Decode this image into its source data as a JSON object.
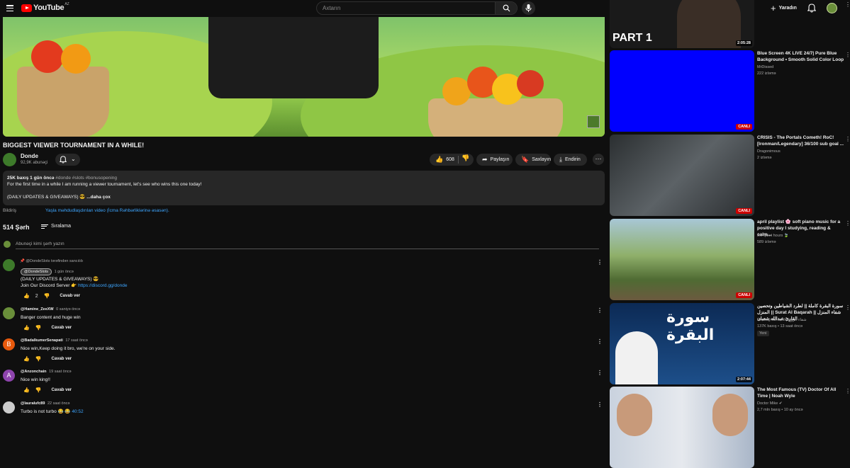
{
  "header": {
    "logo_text": "YouTube",
    "region": "AZ",
    "search_placeholder": "Axtarın",
    "create_label": "Yaradın"
  },
  "video": {
    "title": "BIGGEST VIEWER TOURNAMENT IN A WHILE!",
    "channel": "Donde",
    "subscribers": "92,9K abunəçi",
    "likes": "608",
    "share_label": "Paylaşın",
    "save_label": "Saxlayın",
    "download_label": "Endirin"
  },
  "description": {
    "meta": "25K baxış  1 gün öncə",
    "tags": "#donde #slots #bonusopening",
    "line1": "For the first time in a while I am running a viewer tournament, let's see who wins this one today!",
    "line2": "(DAILY UPDATES & GIVEAWAYS) 😎",
    "more": "...daha çox"
  },
  "notice": {
    "label": "Bildiriş",
    "link": "Yaşla məhdudlaşdırılan video (İcma Rəhbərliklərinə əsasən)."
  },
  "comments_section": {
    "count": "514 Şərh",
    "sort_label": "Sıralama",
    "add_placeholder": "Abunəçi kimi şərh yazın"
  },
  "comments": [
    {
      "pinned": "@DondeSlots tərəfindən sancılıb",
      "handle": "@DondeSlots",
      "time": "1 gün öncə",
      "text1": "(DAILY UPDATES & GIVEAWAYS) 😎",
      "text2": "Join Our Discord Server 👉 ",
      "link": "https://discord.gg/donde",
      "likes": "2",
      "reply": "Cavab ver",
      "avatar_letter": "",
      "avatar_color": "#3d7a2a"
    },
    {
      "handle": "@Hamine_ZeeXW",
      "time": "0 saniyə öncə",
      "text1": "Banger content and huge win",
      "reply": "Cavab ver",
      "avatar_letter": "",
      "avatar_color": "#6a8f3a"
    },
    {
      "handle": "@BadalkumerSenapati",
      "time": "17 saat öncə",
      "text1": "Nice win,Keep doing it bro, we're on your side.",
      "reply": "Cavab ver",
      "avatar_letter": "B",
      "avatar_color": "#e8590c"
    },
    {
      "handle": "@Anzonchain",
      "time": "19 saat öncə",
      "text1": "Nice win king!!",
      "reply": "Cavab ver",
      "avatar_letter": "A",
      "avatar_color": "#8e44ad"
    },
    {
      "handle": "@lauralufc89",
      "time": "22 saat öncə",
      "text1": "Turbo is not turbo 😂 😂 ",
      "link": "40:52",
      "avatar_letter": "",
      "avatar_color": "#cccccc"
    }
  ],
  "recommendations": [
    {
      "thumb_text": "PART 1",
      "duration": "2:05:28",
      "thumb_color": "#1a1a1a"
    },
    {
      "title": "Blue Screen 4K LIVE 24/7| Pure Blue Background • Smooth Solid Color Loop",
      "channel": "MrDissed",
      "views": "222 izləmə",
      "live": "CANLI",
      "thumb_color": "#0000ff"
    },
    {
      "title": "CRISIS - The Portals Cometh! RoC! [Ironman/Legendary] 36/100 sub goal ...",
      "channel": "Dragonimous",
      "views": "2 izləmə",
      "live": "CANLI",
      "thumb_color": "#4a4f52"
    },
    {
      "title": "april playlist 🌸 soft piano music for a positive day l studying, reading & calm...",
      "channel": "the quiet hours 🍃",
      "views": "589 izləmə",
      "live": "CANLI",
      "thumb_color": "#6d8f4e"
    },
    {
      "title": "سورة البقرة كاملة || لطرد الشياطين وتحصين المنزل || Surat Al Baqarah || شفاء المنزل القارئ عبدالله شعبان",
      "channel": "Healing the soul | شفاء الروح",
      "views": "137K baxış • 13 saat öncə",
      "badge": "Yeni",
      "duration": "2:07:44",
      "thumb_color": "#12325e",
      "thumb_text": "سورة البقرة"
    },
    {
      "title": "The Most Famous (TV) Doctor Of All Time | Noah Wyle",
      "channel": "Doctor Mike ✔",
      "views": "2,7 mln baxış • 10 ay öncə",
      "thumb_color": "#b8c4d6"
    }
  ]
}
